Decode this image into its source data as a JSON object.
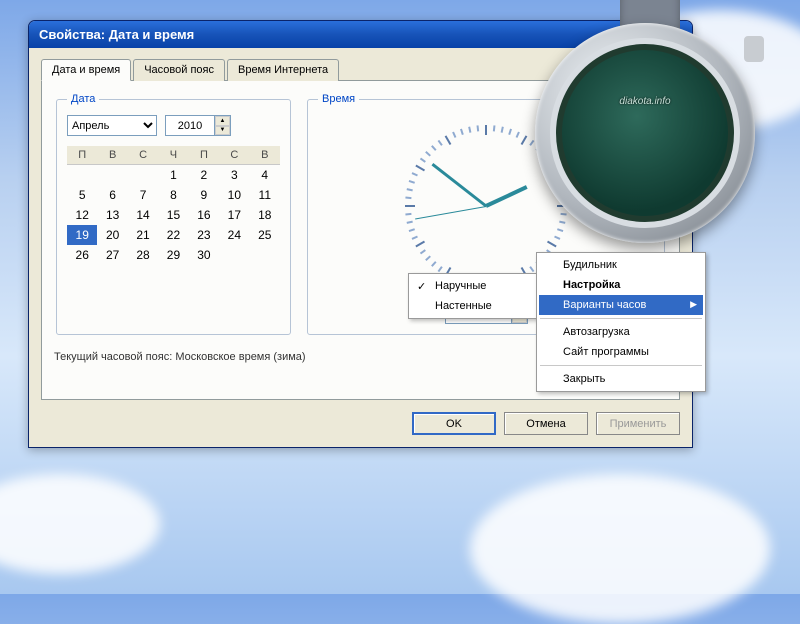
{
  "window": {
    "title": "Свойства: Дата и время"
  },
  "tabs": {
    "date_time": "Дата и время",
    "timezone": "Часовой пояс",
    "internet_time": "Время Интернета"
  },
  "date_group": {
    "legend": "Дата",
    "month": "Апрель",
    "year": "2010",
    "weekdays": [
      "П",
      "В",
      "С",
      "Ч",
      "П",
      "С",
      "В"
    ],
    "grid": [
      [
        "",
        "",
        "",
        "1",
        "2",
        "3",
        "4"
      ],
      [
        "5",
        "6",
        "7",
        "8",
        "9",
        "10",
        "11"
      ],
      [
        "12",
        "13",
        "14",
        "15",
        "16",
        "17",
        "18"
      ],
      [
        "19",
        "20",
        "21",
        "22",
        "23",
        "24",
        "25"
      ],
      [
        "26",
        "27",
        "28",
        "29",
        "30",
        "",
        ""
      ]
    ],
    "selected_day": "19"
  },
  "time_group": {
    "legend": "Время",
    "value": "14:50:43"
  },
  "tz_note": "Текущий часовой пояс: Московское время (зима)",
  "buttons": {
    "ok": "OK",
    "cancel": "Отмена",
    "apply": "Применить"
  },
  "submenu": {
    "wrist": "Наручные",
    "wall": "Настенные"
  },
  "mainmenu": {
    "alarm": "Будильник",
    "settings": "Настройка",
    "variants": "Варианты часов",
    "autoload": "Автозагрузка",
    "site": "Сайт программы",
    "close": "Закрыть"
  },
  "watch": {
    "brand": "diakota.info"
  }
}
